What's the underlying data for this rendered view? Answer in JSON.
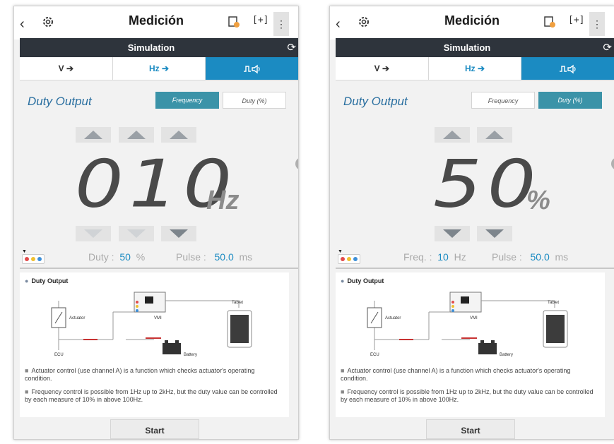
{
  "panels": [
    {
      "header": {
        "title": "Medición"
      },
      "sim_label": "Simulation",
      "tabs": [
        {
          "label": "V ➔"
        },
        {
          "label": "Hz ➔"
        },
        {
          "label": "⎍🔊"
        }
      ],
      "active_tab": 2,
      "duty_title": "Duty Output",
      "toggle_frequency": "Frequency",
      "toggle_duty": "Duty (%)",
      "selected_toggle": "frequency",
      "display_value": "010",
      "display_unit": "Hz",
      "readout": {
        "label": "Duty :",
        "value": "50",
        "unit": "%",
        "pulse_label": "Pulse :",
        "pulse_value": "50.0",
        "pulse_unit": "ms"
      },
      "diagram": {
        "heading": "Duty Output",
        "labels": {
          "actuator": "Actuator",
          "vmi": "VMI",
          "tablet": "Tablet",
          "battery": "Battery",
          "ecu": "ECU"
        },
        "notes": [
          "Actuator control (use channel A) is a function which checks actuator's operating condition.",
          "Frequency control is possible from 1Hz up to 2kHz, but the duty value can be controlled by each measure of 10% in above 100Hz."
        ]
      },
      "start_label": "Start"
    },
    {
      "header": {
        "title": "Medición"
      },
      "sim_label": "Simulation",
      "tabs": [
        {
          "label": "V ➔"
        },
        {
          "label": "Hz ➔"
        },
        {
          "label": "⎍🔊"
        }
      ],
      "active_tab": 2,
      "duty_title": "Duty Output",
      "toggle_frequency": "Frequency",
      "toggle_duty": "Duty (%)",
      "selected_toggle": "duty",
      "display_value": "50",
      "display_unit": "%",
      "readout": {
        "label": "Freq. :",
        "value": "10",
        "unit": "Hz",
        "pulse_label": "Pulse :",
        "pulse_value": "50.0",
        "pulse_unit": "ms"
      },
      "diagram": {
        "heading": "Duty Output",
        "labels": {
          "actuator": "Actuator",
          "vmi": "VMI",
          "tablet": "Tablet",
          "battery": "Battery",
          "ecu": "ECU"
        },
        "notes": [
          "Actuator control (use channel A) is a function which checks actuator's operating condition.",
          "Frequency control is possible from 1Hz up to 2kHz, but the duty value can be controlled by each measure of 10% in above 100Hz."
        ]
      },
      "start_label": "Start"
    }
  ],
  "colors": {
    "accent": "#1b8bc2",
    "toggle_on": "#3b93a8",
    "simbar": "#2e343c",
    "digit": "#4a4a4a"
  },
  "icons": [
    "back-icon",
    "gear-icon",
    "report-icon",
    "capture-icon",
    "more-icon",
    "refresh-icon",
    "arrow-up-icon",
    "arrow-down-icon",
    "probe-icon"
  ]
}
